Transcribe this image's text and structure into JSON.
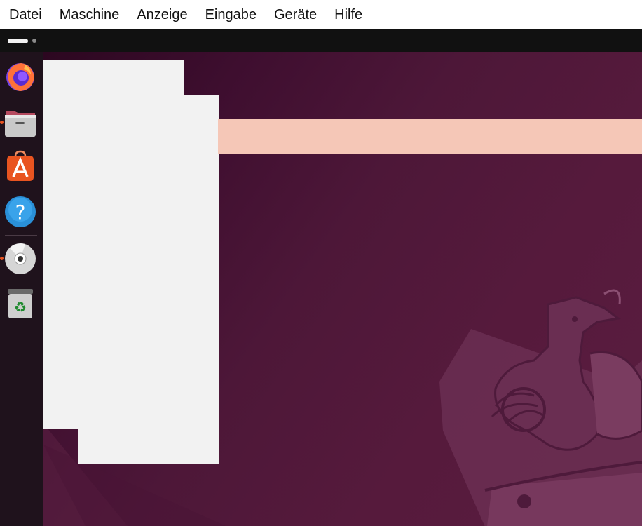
{
  "menubar": {
    "items": [
      {
        "label": "Datei"
      },
      {
        "label": "Maschine"
      },
      {
        "label": "Anzeige"
      },
      {
        "label": "Eingabe"
      },
      {
        "label": "Geräte"
      },
      {
        "label": "Hilfe"
      }
    ]
  },
  "dock": {
    "apps": [
      {
        "icon": "firefox-icon",
        "running": false
      },
      {
        "icon": "files-icon",
        "running": true
      },
      {
        "icon": "app-center-icon",
        "running": false
      },
      {
        "icon": "help-icon",
        "running": false
      },
      {
        "icon": "dvd-icon",
        "running": true
      },
      {
        "icon": "trash-icon",
        "running": false
      }
    ]
  },
  "colors": {
    "accent": "#e95420",
    "desktop": "#561a3c",
    "banner": "#f5c7b7"
  }
}
